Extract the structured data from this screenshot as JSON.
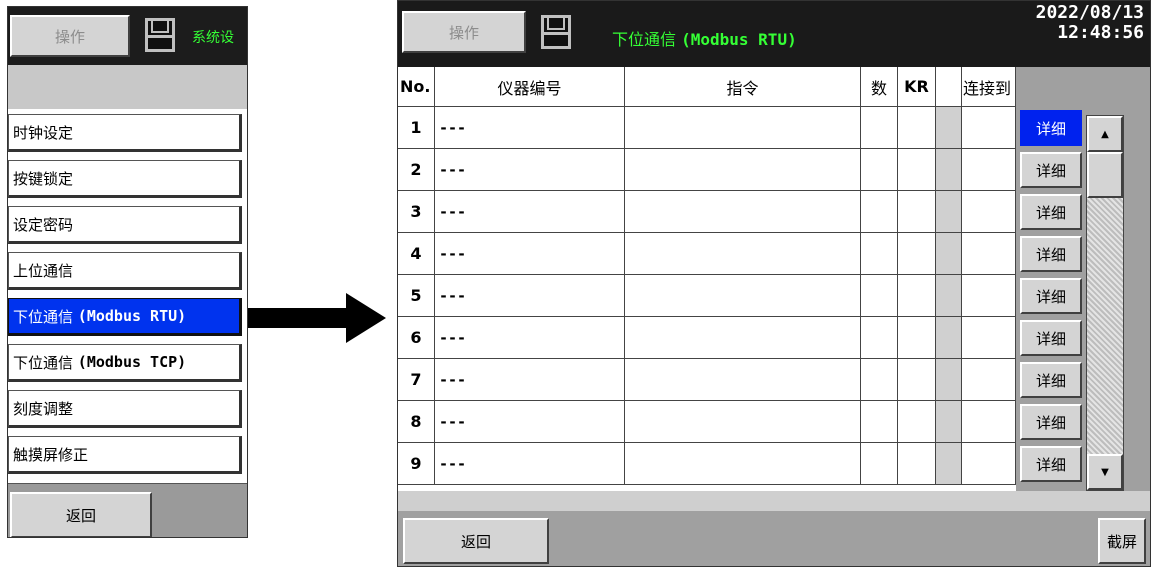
{
  "left_panel": {
    "operate_label": "操作",
    "title_partial": "系统设",
    "menu_items": [
      {
        "label": "时钟设定"
      },
      {
        "label": "按键锁定"
      },
      {
        "label": "设定密码"
      },
      {
        "label": "上位通信"
      },
      {
        "label_cn": "下位通信",
        "label_en": "(Modbus RTU)",
        "selected": true
      },
      {
        "label_cn": "下位通信",
        "label_en": "(Modbus TCP)"
      },
      {
        "label": "刻度调整"
      },
      {
        "label": "触摸屏修正"
      }
    ],
    "back_label": "返回"
  },
  "right_panel": {
    "operate_label": "操作",
    "title_cn": "下位通信",
    "title_en": "(Modbus RTU)",
    "date": "2022/08/13",
    "time": "12:48:56",
    "columns": [
      "No.",
      "仪器编号",
      "指令",
      "数",
      "KR",
      "",
      "连接到"
    ],
    "rows": [
      {
        "no": "1",
        "id": "---"
      },
      {
        "no": "2",
        "id": "---"
      },
      {
        "no": "3",
        "id": "---"
      },
      {
        "no": "4",
        "id": "---"
      },
      {
        "no": "5",
        "id": "---"
      },
      {
        "no": "6",
        "id": "---"
      },
      {
        "no": "7",
        "id": "---"
      },
      {
        "no": "8",
        "id": "---"
      },
      {
        "no": "9",
        "id": "---"
      }
    ],
    "detail_label": "详细",
    "back_label": "返回",
    "screenshot_label": "截屏"
  },
  "colors": {
    "title_green": "#35ff35",
    "selected_blue": "#0033ee",
    "header_black": "#1a1a1a"
  },
  "icons": [
    "floppy-disk-icon",
    "arrow-right-icon",
    "scroll-up-icon",
    "scroll-down-icon"
  ]
}
